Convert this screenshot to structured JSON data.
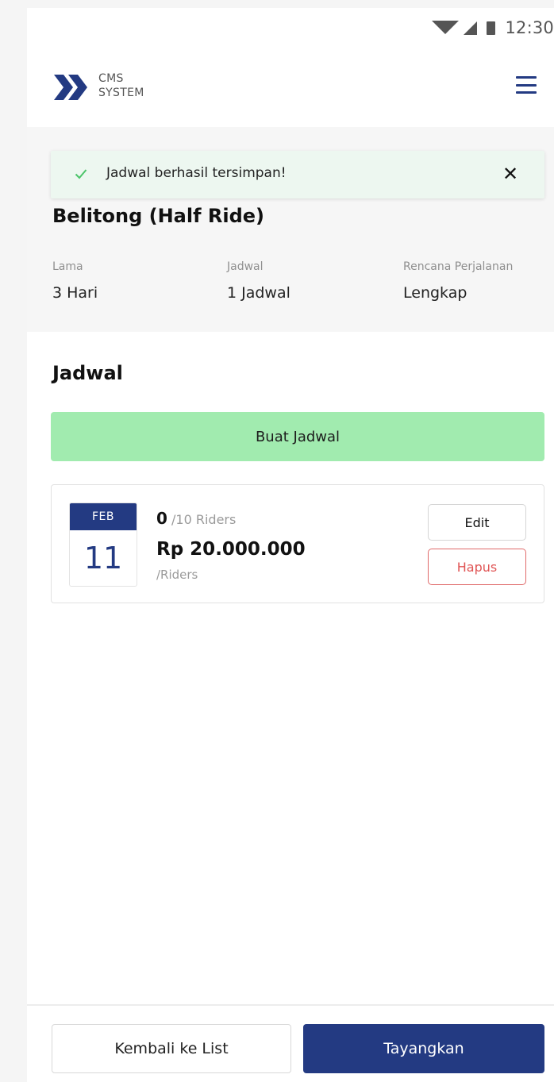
{
  "status_bar": {
    "time": "12:30",
    "icons": [
      "wifi-icon",
      "signal-icon",
      "battery-icon"
    ]
  },
  "header": {
    "logo_line1": "CMS",
    "logo_line2": "SYSTEM",
    "menu_icon": "hamburger-menu-icon"
  },
  "toast": {
    "message": "Jadwal berhasil tersimpan!",
    "close_label": "✕",
    "icon": "check-icon"
  },
  "trip": {
    "title": "Belitong (Half Ride)",
    "stats": [
      {
        "label": "Lama",
        "value": "3 Hari"
      },
      {
        "label": "Jadwal",
        "value": "1 Jadwal"
      },
      {
        "label": "Rencana Perjalanan",
        "value": "Lengkap"
      }
    ]
  },
  "schedule": {
    "section_title": "Jadwal",
    "create_label": "Buat Jadwal",
    "items": [
      {
        "month": "FEB",
        "day": "11",
        "riders_count": "0",
        "riders_total": "/10 Riders",
        "price": "Rp 20.000.000",
        "price_unit": "/Riders",
        "edit_label": "Edit",
        "delete_label": "Hapus"
      }
    ]
  },
  "footer": {
    "back_label": "Kembali ke List",
    "publish_label": "Tayangkan"
  },
  "colors": {
    "primary": "#233a82",
    "success_button": "#a1ebaf",
    "toast_bg": "#edf7f0",
    "danger": "#e05555",
    "check": "#4cc46a"
  }
}
